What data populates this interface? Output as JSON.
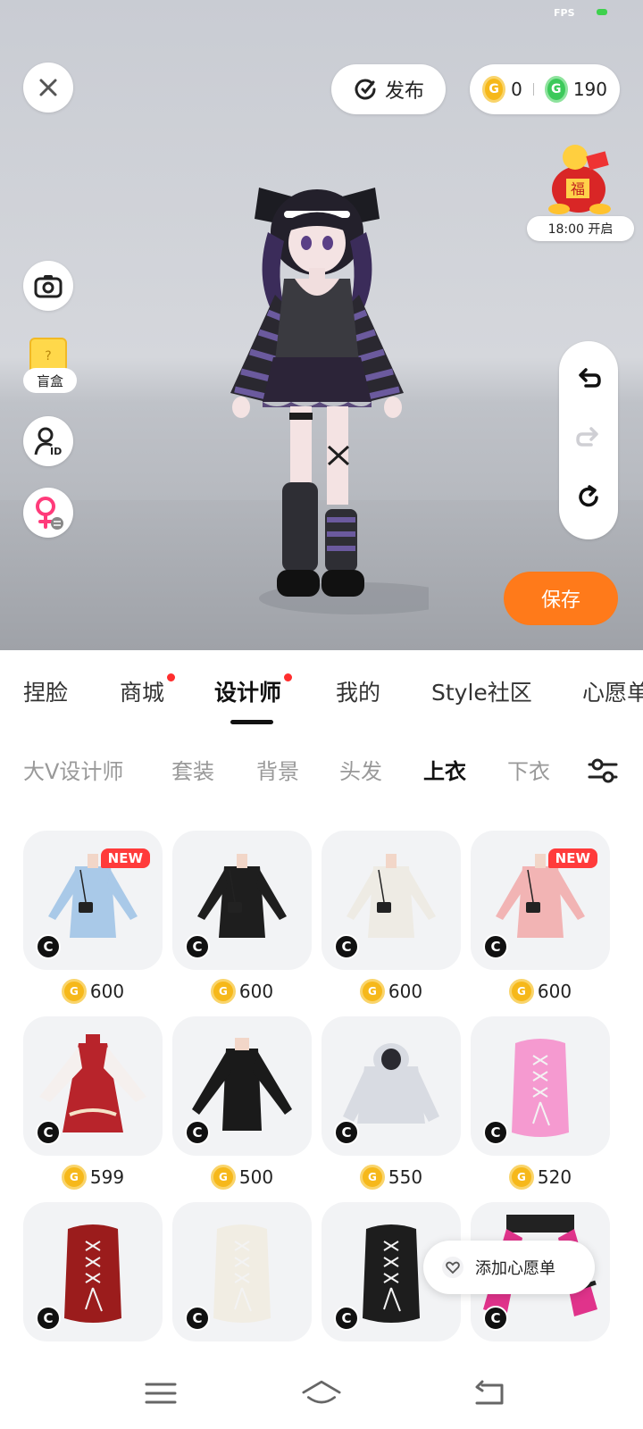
{
  "status": {
    "fps_label": "FPS"
  },
  "top_bar": {
    "publish_label": "发布",
    "gold_coins": "0",
    "green_coins": "190",
    "coin_glyph": "G"
  },
  "event": {
    "time_label": "18:00 开启"
  },
  "left_tools": {
    "mystery_box_label": "盲盒"
  },
  "save_label": "保存",
  "main_tabs": [
    {
      "label": "捏脸",
      "dot": false,
      "active": false
    },
    {
      "label": "商城",
      "dot": true,
      "active": false
    },
    {
      "label": "设计师",
      "dot": true,
      "active": true
    },
    {
      "label": "我的",
      "dot": false,
      "active": false
    },
    {
      "label": "Style社区",
      "dot": false,
      "active": false
    },
    {
      "label": "心愿单",
      "dot": false,
      "active": false
    }
  ],
  "sub_tabs": [
    {
      "label": "大V设计师",
      "active": false
    },
    {
      "label": "套装",
      "active": false
    },
    {
      "label": "背景",
      "active": false
    },
    {
      "label": "头发",
      "active": false
    },
    {
      "label": "上衣",
      "active": true
    },
    {
      "label": "下衣",
      "active": false
    }
  ],
  "items": [
    {
      "price": "600",
      "new": true,
      "new_label": "NEW",
      "color": "#a9c9e8",
      "kind": "dress"
    },
    {
      "price": "600",
      "new": false,
      "color": "#1e1e1e",
      "kind": "dress"
    },
    {
      "price": "600",
      "new": false,
      "color": "#eeebe4",
      "kind": "dress"
    },
    {
      "price": "600",
      "new": true,
      "new_label": "NEW",
      "color": "#f2b4b4",
      "kind": "dress"
    },
    {
      "price": "599",
      "new": false,
      "color": "#b8242b",
      "kind": "hanfu"
    },
    {
      "price": "500",
      "new": false,
      "color": "#1a1a1a",
      "kind": "longsleeve"
    },
    {
      "price": "550",
      "new": false,
      "color": "#d8dbe2",
      "kind": "hoodie"
    },
    {
      "price": "520",
      "new": false,
      "color": "#f59ad0",
      "kind": "corset"
    },
    {
      "price": "",
      "new": false,
      "color": "#9b1c1c",
      "kind": "corset"
    },
    {
      "price": "",
      "new": false,
      "color": "#f1ede3",
      "kind": "corset"
    },
    {
      "price": "",
      "new": false,
      "color": "#1d1d1d",
      "kind": "corset"
    },
    {
      "price": "",
      "new": false,
      "color": "#e0338b",
      "kind": "sleeves"
    }
  ],
  "item_badge": "C",
  "wishlist_label": "添加心愿单",
  "colors": {
    "accent_orange": "#ff7a1a",
    "red_dot": "#ff2e2e",
    "coin_gold": "#f6b81a",
    "coin_green": "#3cc95a"
  }
}
